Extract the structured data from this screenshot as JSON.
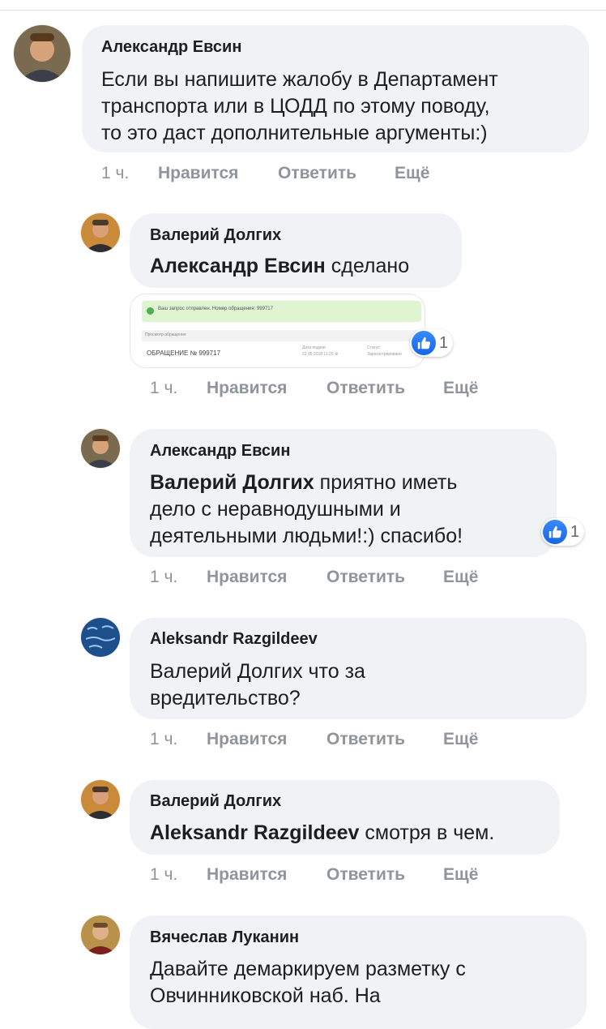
{
  "comments": [
    {
      "author": "Александр Евсин",
      "lines": [
        "Если вы напишите жалобу в Департамент",
        "транспорта или в ЦОДД по этому поводу,",
        "то это даст дополнительные аргументы:)"
      ],
      "time": "1 ч."
    },
    {
      "author": "Валерий Долгих",
      "mention": "Александр Евсин",
      "text": "сделано",
      "time": "1 ч.",
      "reactions": "1",
      "attachment": {
        "banner": "Ваш запрос отправлен. Номер обращения: 999717",
        "sub": "Просмотр обращения",
        "number": "ОБРАЩЕНИЕ № 999717",
        "col1_label": "Дата подачи",
        "col1_value": "22.05.2018 11:20 ⊕",
        "col2_label": "Статус",
        "col2_value": "Зарегистрировано"
      }
    },
    {
      "author": "Александр Евсин",
      "mention": "Валерий Долгих",
      "line1": "приятно иметь",
      "line2": "дело с неравнодушными и",
      "line3": "деятельными людьми!:) спасибо!",
      "time": "1 ч.",
      "reactions": "1"
    },
    {
      "author": "Aleksandr Razgildeev",
      "lines": [
        "Валерий Долгих что за",
        "вредительство?"
      ],
      "time": "1 ч."
    },
    {
      "author": "Валерий Долгих",
      "mention": "Aleksandr Razgildeev",
      "text": "смотря в чем.",
      "time": "1 ч."
    },
    {
      "author": "Вячеслав Луканин",
      "lines": [
        "Давайте демаркируем разметку с",
        "Овчинниковской наб. На"
      ]
    }
  ],
  "actions": {
    "like": "Нравится",
    "reply": "Ответить",
    "more": "Ещё"
  },
  "colors": {
    "bubble": "#f0f2f5",
    "meta": "#90949c",
    "like": "#1877f2"
  },
  "icons": [
    "avatar",
    "like-icon"
  ]
}
